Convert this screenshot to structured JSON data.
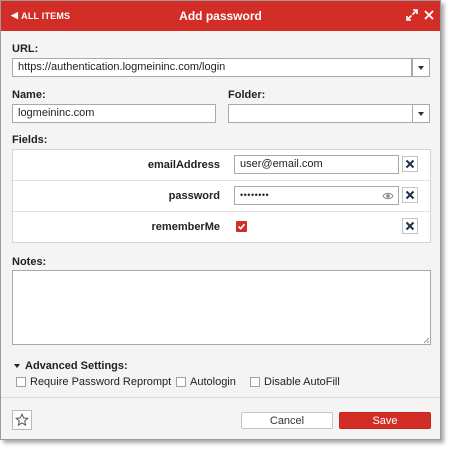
{
  "header": {
    "back_label": "ALL ITEMS",
    "title": "Add password",
    "color": "#d32d27"
  },
  "url": {
    "label": "URL:",
    "value": "https://authentication.logmeininc.com/login"
  },
  "name": {
    "label": "Name:",
    "value": "logmeininc.com"
  },
  "folder": {
    "label": "Folder:",
    "value": ""
  },
  "fields": {
    "label": "Fields:",
    "rows": [
      {
        "name": "emailAddress",
        "value": "user@email.com"
      },
      {
        "name": "password",
        "value": "••••••••"
      },
      {
        "name": "rememberMe",
        "checked": true
      }
    ]
  },
  "notes": {
    "label": "Notes:",
    "value": ""
  },
  "advanced": {
    "label": "Advanced Settings:",
    "options": [
      {
        "label": "Require Password Reprompt",
        "checked": false
      },
      {
        "label": "Autologin",
        "checked": false
      },
      {
        "label": "Disable AutoFill",
        "checked": false
      }
    ]
  },
  "footer": {
    "cancel_label": "Cancel",
    "save_label": "Save"
  },
  "icons": [
    "chevron-left-icon",
    "expand-icon",
    "close-icon",
    "chevron-down-icon",
    "eye-icon",
    "delete-icon",
    "checkmark-icon",
    "star-icon",
    "resize-grip-icon"
  ]
}
